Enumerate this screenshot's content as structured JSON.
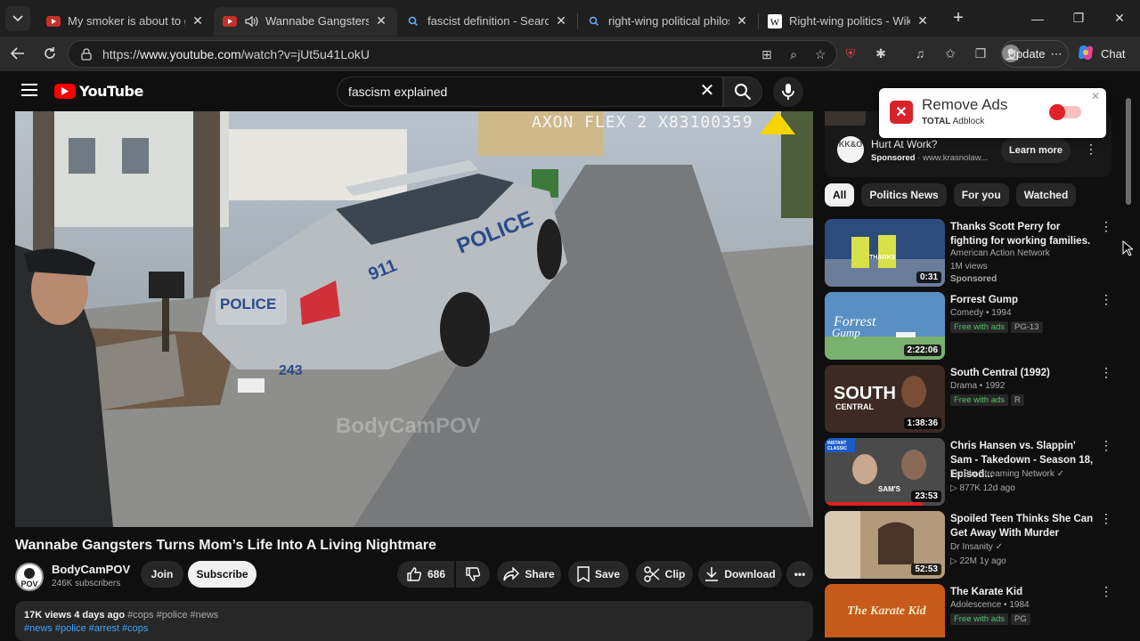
{
  "tabs": [
    {
      "title": "My smoker is about to get a",
      "active": false
    },
    {
      "title": "Wannabe Gangsters Tu",
      "active": true
    },
    {
      "title": "fascist definition - Search",
      "active": false
    },
    {
      "title": "right-wing political philosop",
      "active": false
    },
    {
      "title": "Right-wing politics - Wikipe",
      "active": false
    }
  ],
  "browser": {
    "url_prefix": "https://",
    "url_host": "www.youtube.com",
    "url_path": "/watch?v=jUt5u41LokU",
    "update_label": "Update",
    "chat_label": "Chat"
  },
  "youtube": {
    "logo_text": "YouTube",
    "search_value": "fascism explained"
  },
  "video": {
    "overlay": "AXON FLEX 2 X83100359",
    "watermark": "BodyCamPOV",
    "title": "Wannabe Gangsters Turns Mom’s Life Into A Living Nightmare",
    "channel": "BodyCamPOV",
    "subscribers": "246K subscribers",
    "join_label": "Join",
    "subscribe_label": "Subscribe",
    "likes": "686",
    "share_label": "Share",
    "save_label": "Save",
    "clip_label": "Clip",
    "download_label": "Download",
    "views_date": "17K views  4 days ago",
    "desc_tags": "#cops #police #news",
    "hashtags": "#news #police #arrest #cops"
  },
  "ad": {
    "logo_text": "KK&O",
    "title": "Hurt At Work?",
    "sponsored": "Sponsored",
    "domain": "www.krasnolaw...",
    "cta": "Learn more"
  },
  "popup": {
    "title": "Remove Ads",
    "brand_bold": "TOTAL",
    "brand_rest": "Adblock",
    "toggle_on": false
  },
  "chips": [
    "All",
    "Politics News",
    "For you",
    "Watched"
  ],
  "recommendations": [
    {
      "title": "Thanks Scott Perry for fighting for working families.",
      "line1": "American Action Network",
      "line2": "1M views",
      "line3": "Sponsored",
      "duration": "0:31",
      "thumb_color": "#2c4c7d"
    },
    {
      "title": "Forrest Gump",
      "line1": "Comedy • 1994",
      "free": "Free with ads",
      "rating": "PG-13",
      "duration": "2:22:06",
      "thumb_color": "#5a8fc4"
    },
    {
      "title": "South Central (1992)",
      "line1": "Drama • 1992",
      "free": "Free with ads",
      "rating": "R",
      "duration": "1:38:36",
      "thumb_color": "#3d2a22"
    },
    {
      "title": "Chris Hansen vs. Slappin' Sam - Takedown - Season 18, Episod...",
      "line1": "TruBlu Streaming Network ✓",
      "line2": "▷ 877K  12d ago",
      "duration": "23:53",
      "thumb_color": "#4a4a4a"
    },
    {
      "title": "Spoiled Teen Thinks She Can Get Away With Murder",
      "line1": "Dr Insanity ✓",
      "line2": "▷ 22M  1y ago",
      "duration": "52:53",
      "thumb_color": "#b29a7a"
    },
    {
      "title": "The Karate Kid",
      "line1": "Adolescence • 1984",
      "free": "Free with ads",
      "rating": "PG",
      "duration": "",
      "thumb_color": "#c55a1a"
    }
  ]
}
